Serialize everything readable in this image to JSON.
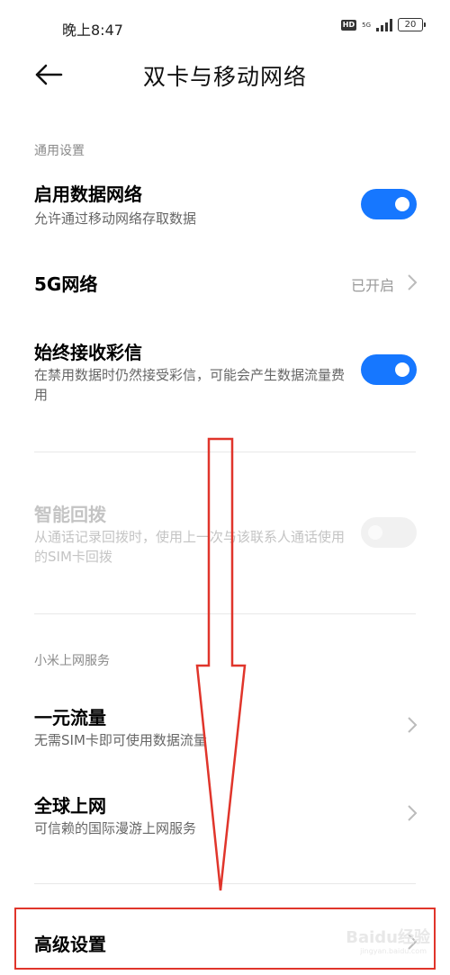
{
  "status": {
    "time": "晚上8:47",
    "hd": "HD",
    "network": "5G",
    "battery": "20"
  },
  "header": {
    "title": "双卡与移动网络"
  },
  "sections": {
    "general": "通用设置",
    "xiaomi": "小米上网服务"
  },
  "rows": {
    "data_network": {
      "title": "启用数据网络",
      "subtitle": "允许通过移动网络存取数据",
      "enabled": true
    },
    "five_g": {
      "title": "5G网络",
      "value": "已开启"
    },
    "mms": {
      "title": "始终接收彩信",
      "subtitle": "在禁用数据时仍然接受彩信，可能会产生数据流量费用",
      "enabled": true
    },
    "smart_redial": {
      "title": "智能回拨",
      "subtitle": "从通话记录回拨时，使用上一次与该联系人通话使用的SIM卡回拨",
      "enabled": false,
      "disabled": true
    },
    "one_yuan": {
      "title": "一元流量",
      "subtitle": "无需SIM卡即可使用数据流量"
    },
    "global": {
      "title": "全球上网",
      "subtitle": "可信赖的国际漫游上网服务"
    },
    "advanced": {
      "title": "高级设置"
    }
  },
  "annotation": {
    "color": "#e0352b"
  },
  "watermark": {
    "text": "Baidu经验",
    "url": "jingyan.baidu.com"
  },
  "colors": {
    "accent": "#1677ff",
    "annotation": "#e0352b"
  }
}
